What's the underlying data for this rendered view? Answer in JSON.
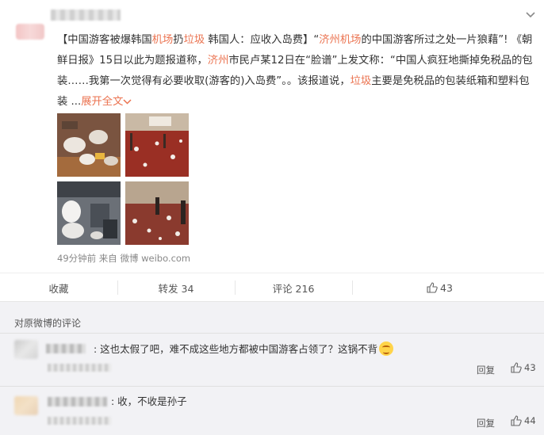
{
  "post": {
    "text_segments": [
      {
        "t": "【中国游客被爆韩国",
        "hl": false
      },
      {
        "t": "机场",
        "hl": true
      },
      {
        "t": "扔",
        "hl": false
      },
      {
        "t": "垃圾",
        "hl": true
      },
      {
        "t": " 韩国人：应收入岛费】",
        "hl": false
      },
      {
        "t": "“",
        "hl": false
      },
      {
        "t": "济州机场",
        "hl": true
      },
      {
        "t": "的中国游客所过之处一片狼藉”! 《朝鲜日报》15日以此为题报道称，",
        "hl": false
      },
      {
        "t": "济州",
        "hl": true
      },
      {
        "t": "市民卢某12日在“脸谱”上发文称：“中国人疯狂地撕掉免税品的包装……我第一次觉得有必要收取(游客的)入岛费”。。该报道说，",
        "hl": false
      },
      {
        "t": "垃圾",
        "hl": true
      },
      {
        "t": "主要是免税品的包装纸箱和塑料包装 ...",
        "hl": false
      }
    ],
    "expand_label": "展开全文",
    "meta": "49分钟前 来自 微博 weibo.com"
  },
  "actions": {
    "favorite": "收藏",
    "repost": "转发 34",
    "comment": "评论 216",
    "like_count": "43"
  },
  "comments_section": {
    "title": "对原微博的评论",
    "comments": [
      {
        "text": ": 这也太假了吧，难不成这些地方都被中国游客占领了？这锅不背",
        "emoji": "thinking-face",
        "reply": "回复",
        "likes": "43"
      },
      {
        "text": ": 收，不收是孙子",
        "reply": "回复",
        "likes": "44"
      }
    ]
  },
  "colors": {
    "accent": "#eb7350",
    "text": "#333333",
    "muted": "#888888",
    "bg": "#f2f2f5"
  }
}
